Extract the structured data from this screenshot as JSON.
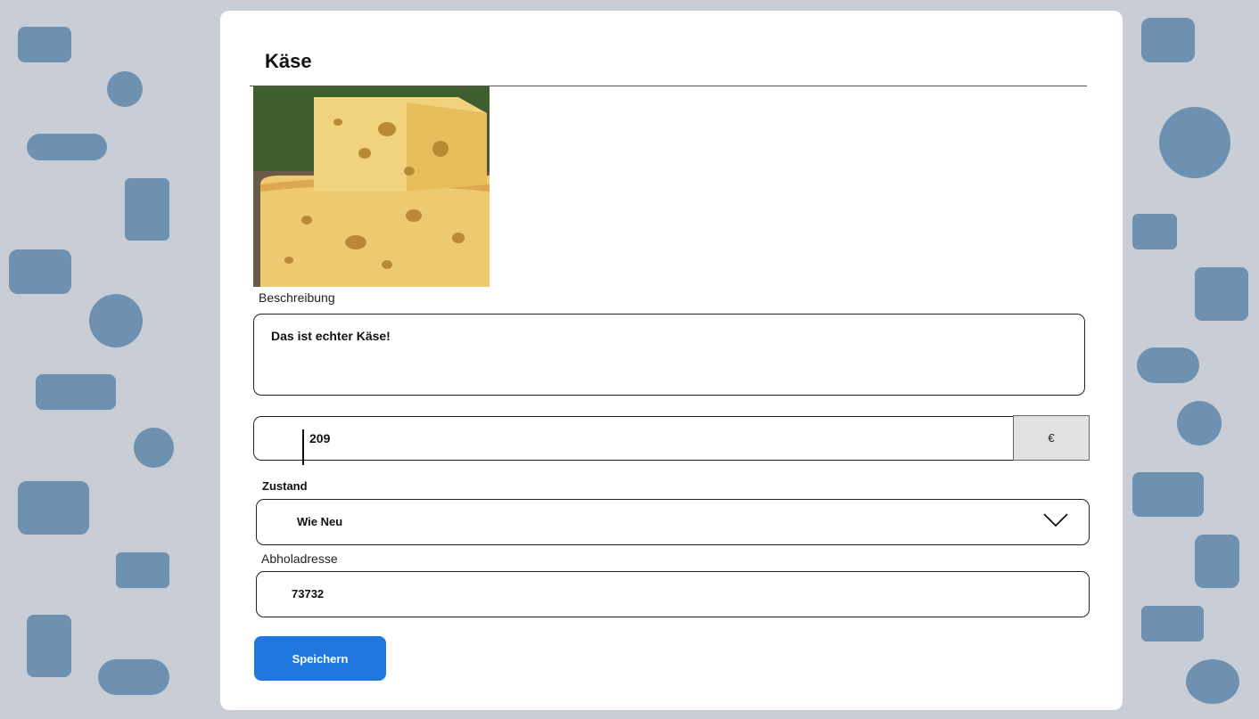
{
  "item": {
    "title": "Käse"
  },
  "description": {
    "label": "Beschreibung",
    "value": "Das ist echter Käse!"
  },
  "price": {
    "value": "209",
    "currency": "€"
  },
  "condition": {
    "label": "Zustand",
    "selected": "Wie Neu"
  },
  "address": {
    "label": "Abholadresse",
    "value": "73732"
  },
  "actions": {
    "save_label": "Speichern"
  },
  "colors": {
    "primary": "#1f78e0",
    "background_pattern": "#3e6f9d"
  }
}
